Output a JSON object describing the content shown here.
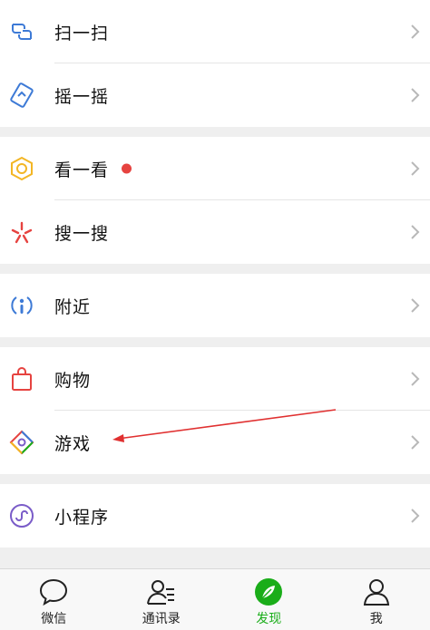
{
  "menu": {
    "groups": [
      {
        "items": [
          {
            "label": "扫一扫",
            "icon": "scan-icon"
          },
          {
            "label": "摇一摇",
            "icon": "shake-icon"
          }
        ]
      },
      {
        "items": [
          {
            "label": "看一看",
            "icon": "top-stories-icon",
            "badge": true
          },
          {
            "label": "搜一搜",
            "icon": "search-icon"
          }
        ]
      },
      {
        "items": [
          {
            "label": "附近",
            "icon": "nearby-icon"
          }
        ]
      },
      {
        "items": [
          {
            "label": "购物",
            "icon": "shopping-bag-icon"
          },
          {
            "label": "游戏",
            "icon": "games-icon"
          }
        ]
      },
      {
        "items": [
          {
            "label": "小程序",
            "icon": "mini-programs-icon"
          }
        ]
      }
    ]
  },
  "tabbar": {
    "tabs": [
      {
        "label": "微信",
        "icon": "chat-bubble-icon",
        "active": false
      },
      {
        "label": "通讯录",
        "icon": "contacts-icon",
        "active": false
      },
      {
        "label": "发现",
        "icon": "discover-compass-icon",
        "active": true
      },
      {
        "label": "我",
        "icon": "profile-icon",
        "active": false
      }
    ]
  },
  "colors": {
    "accent": "#1aad19",
    "badge": "#e64340",
    "annotation_arrow": "#e03030",
    "background": "#efefef"
  }
}
